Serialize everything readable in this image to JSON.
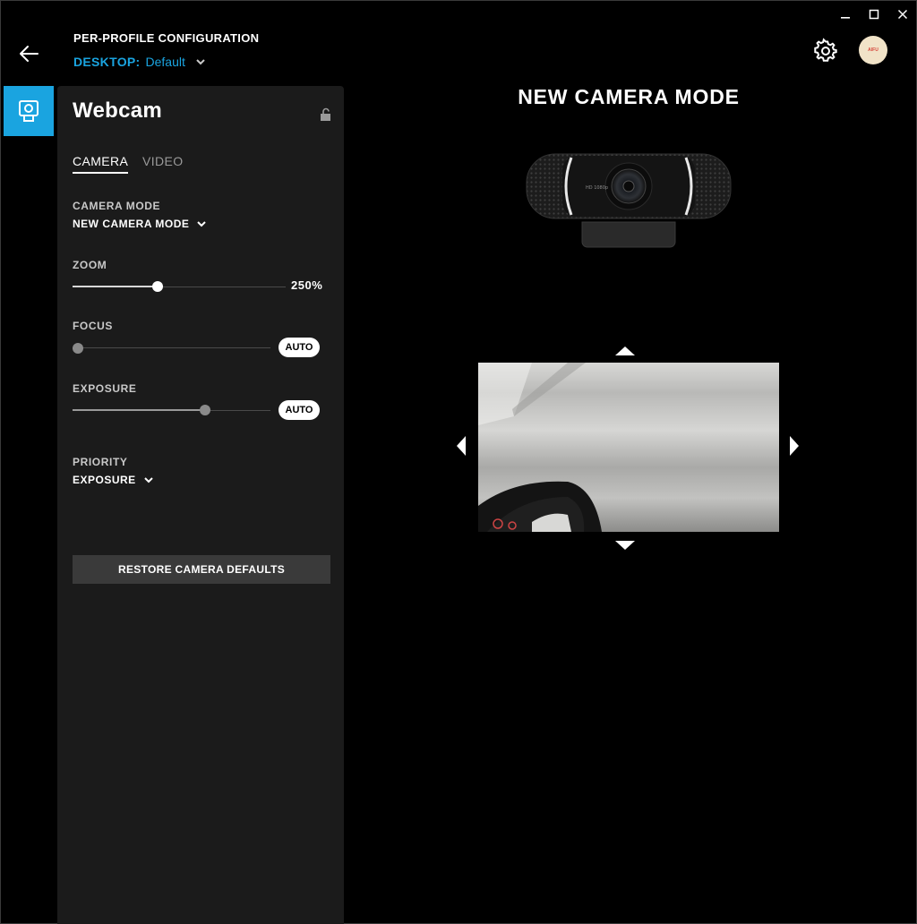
{
  "window": {
    "minimize": "—",
    "maximize": "☐",
    "close": "✕"
  },
  "header": {
    "title": "PER-PROFILE CONFIGURATION",
    "profile_label": "DESKTOP:",
    "profile_value": "Default"
  },
  "avatar": {
    "text": "AIFU"
  },
  "device": {
    "name": "Webcam",
    "tabs": [
      {
        "label": "CAMERA",
        "active": true
      },
      {
        "label": "VIDEO",
        "active": false
      }
    ],
    "camera_mode": {
      "label": "CAMERA MODE",
      "value": "NEW CAMERA MODE"
    },
    "zoom": {
      "label": "ZOOM",
      "value_text": "250%",
      "level": 0.4
    },
    "focus": {
      "label": "FOCUS",
      "level": 0.0,
      "auto_label": "AUTO"
    },
    "exposure": {
      "label": "EXPOSURE",
      "level": 0.67,
      "auto_label": "AUTO"
    },
    "priority": {
      "label": "PRIORITY",
      "value": "EXPOSURE"
    },
    "restore_label": "RESTORE CAMERA DEFAULTS"
  },
  "main": {
    "mode_title": "NEW CAMERA MODE",
    "camera_lens_text": "HD 1080p"
  },
  "colors": {
    "accent": "#1aa4e0",
    "panel": "#1b1b1b",
    "background": "#000000"
  },
  "icons": [
    "back-arrow-icon",
    "settings-gear-icon",
    "webcam-icon",
    "lock-open-icon",
    "chevron-down-icon",
    "pan-up-icon",
    "pan-down-icon",
    "pan-left-icon",
    "pan-right-icon"
  ]
}
